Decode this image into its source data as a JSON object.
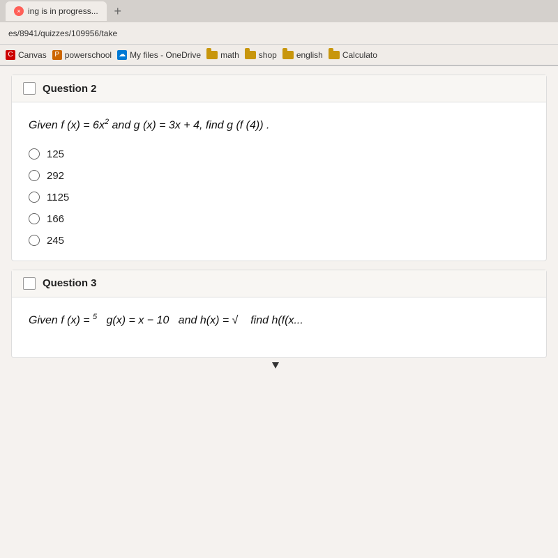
{
  "browser": {
    "tab_label": "ing is in progress...",
    "tab_status": "x",
    "url": "es/8941/quizzes/109956/take",
    "bookmarks": [
      {
        "name": "Canvas",
        "type": "icon",
        "icon_type": "canvas"
      },
      {
        "name": "powerschool",
        "type": "icon",
        "icon_type": "ps"
      },
      {
        "name": "My files - OneDrive",
        "type": "icon",
        "icon_type": "onedrive"
      },
      {
        "name": "math",
        "type": "folder"
      },
      {
        "name": "shop",
        "type": "folder"
      },
      {
        "name": "english",
        "type": "folder"
      },
      {
        "name": "Calculato",
        "type": "folder"
      }
    ]
  },
  "question2": {
    "header": "Question 2",
    "question_text": "Given f (x) = 6x² and g (x) = 3x + 4, find g (f (4)).",
    "options": [
      {
        "value": "125"
      },
      {
        "value": "292"
      },
      {
        "value": "1125"
      },
      {
        "value": "166"
      },
      {
        "value": "245"
      }
    ]
  },
  "question3": {
    "header": "Question 3",
    "question_partial": "Given f (x) = ⁵  g(x) = x − 10  and h(x) = √... find h(f(x..."
  }
}
